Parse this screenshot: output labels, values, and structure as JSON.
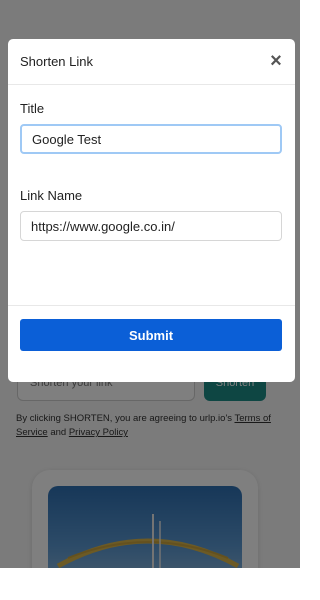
{
  "background_page": {
    "shorten_input_placeholder": "Shorten your link",
    "shorten_button_label": "Shorten",
    "terms": {
      "prefix": "By clicking SHORTEN, you are agreeing to urlp.io's ",
      "terms_link": "Terms of Service",
      "middle": " and ",
      "privacy_link": "Privacy Policy"
    }
  },
  "modal": {
    "title": "Shorten Link",
    "close_icon": "×",
    "fields": {
      "title": {
        "label": "Title",
        "value": "Google Test"
      },
      "link_name": {
        "label": "Link Name",
        "value": "https://www.google.co.in/"
      }
    },
    "submit_label": "Submit"
  },
  "colors": {
    "overlay": "rgba(0,0,0,0.5)",
    "submit_button": "#0b5fd7",
    "focus_border": "#9fc9f5",
    "shorten_button": "#1c8c86"
  }
}
